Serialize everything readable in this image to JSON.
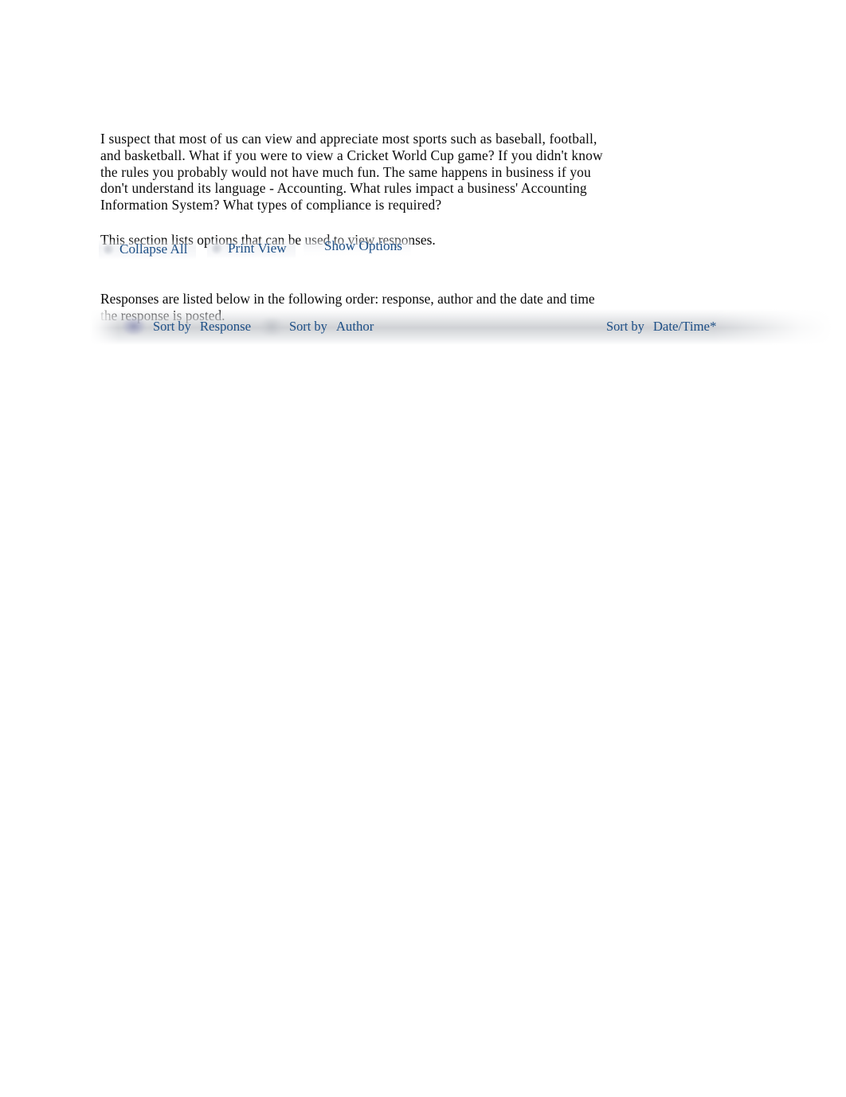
{
  "prompt": {
    "text": "I suspect that most of us can view and appreciate most sports such as baseball, football, and basketball. What if you were to view a Cricket World Cup game? If you didn't know the rules you probably would not have much fun. The same happens in business if you don't understand its language - Accounting. What rules impact a business' Accounting Information System? What types of compliance is required?"
  },
  "options": {
    "intro": "This section lists options that can be used to view responses.",
    "items": [
      {
        "label": "Collapse All",
        "icon": "collapse-icon"
      },
      {
        "label": "Print View",
        "icon": "print-icon"
      },
      {
        "label": "Show Options",
        "icon": "options-icon"
      }
    ]
  },
  "listing": {
    "note": "Responses are listed below in the following order: response, author and the date and time the response is posted."
  },
  "sort_bar": {
    "sort_by_label": "Sort by",
    "items": [
      {
        "field": "Response",
        "icon": "sort-response-icon"
      },
      {
        "field": "Author",
        "icon": "sort-author-icon"
      },
      {
        "field": "Date/Time*",
        "icon": "sort-date-icon"
      }
    ]
  },
  "colors": {
    "link": "#1d4f86",
    "body_text": "#0a0a0a",
    "bar_gradient": "#cdcfd3",
    "page_background": "#ffffff"
  }
}
